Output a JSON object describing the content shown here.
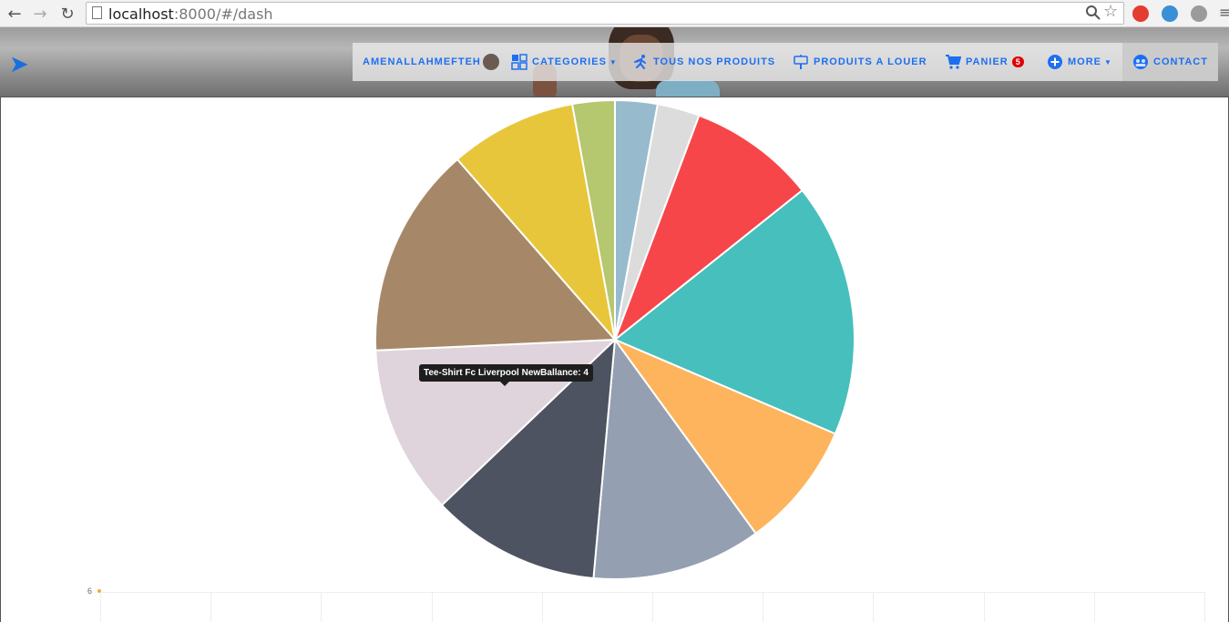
{
  "browser": {
    "url_host": "localhost",
    "url_rest": ":8000/#/dash"
  },
  "navbar": {
    "user_label": "AMENALLAHMEFTEH",
    "categories_label": "CATEGORIES",
    "products_label": "TOUS NOS PRODUITS",
    "rent_label": "PRODUITS A LOUER",
    "cart_label": "PANIER",
    "cart_count": "5",
    "more_label": "MORE",
    "contact_label": "CONTACT",
    "accent_color": "#1e6ff0"
  },
  "tooltip": {
    "text": "Tee-Shirt Fc Liverpool NewBallance: 4"
  },
  "line_chart": {
    "y_tick": "6"
  },
  "chart_data": {
    "type": "pie",
    "slices": [
      {
        "value": 1,
        "color": "#97bbcd"
      },
      {
        "value": 1,
        "color": "#dcdcdc"
      },
      {
        "value": 3,
        "color": "#f7464a"
      },
      {
        "value": 6,
        "color": "#46bfbd"
      },
      {
        "value": 3,
        "color": "#fdb45c"
      },
      {
        "value": 4,
        "color": "#949fb1"
      },
      {
        "value": 4,
        "color": "#4d5360"
      },
      {
        "value": 4,
        "color": "#e0d4dc",
        "label": "Tee-Shirt Fc Liverpool NewBallance"
      },
      {
        "value": 5,
        "color": "#a68868"
      },
      {
        "value": 3,
        "color": "#e8c63b"
      },
      {
        "value": 1,
        "color": "#b5c76f"
      }
    ]
  }
}
